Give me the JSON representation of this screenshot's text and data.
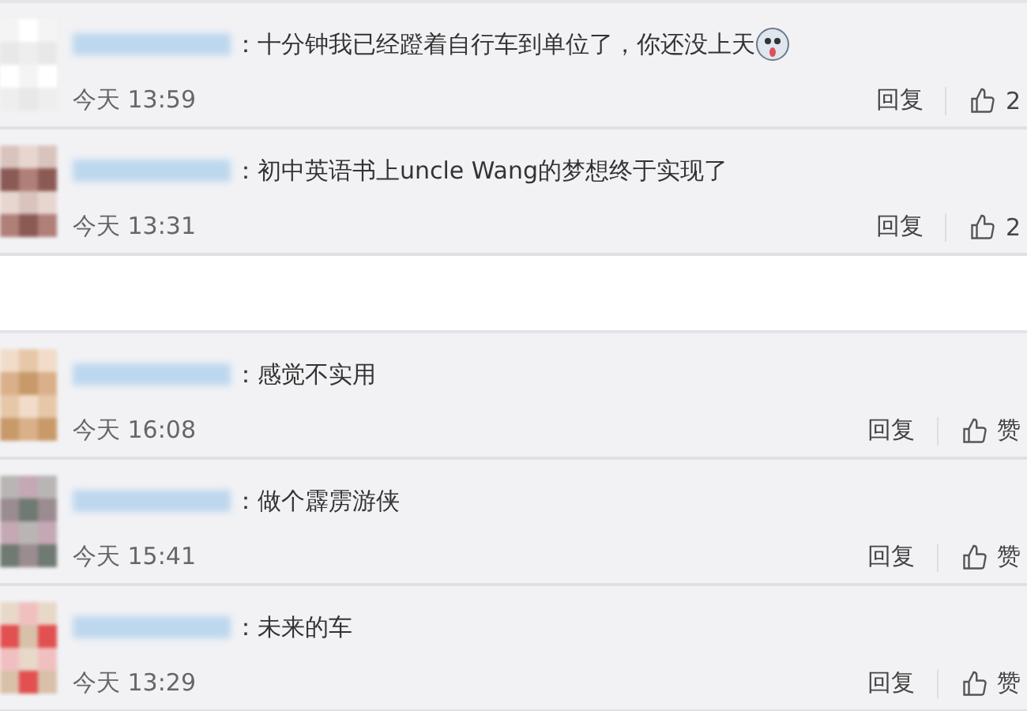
{
  "panels": [
    {
      "comments": [
        {
          "text": "：十分钟我已经蹬着自行车到单位了，你还没上天",
          "emoji": true,
          "time": "今天 13:59",
          "reply": "回复",
          "likes": "2"
        },
        {
          "text": "：初中英语书上uncle Wang的梦想终于实现了",
          "emoji": false,
          "time": "今天 13:31",
          "reply": "回复",
          "likes": "2"
        }
      ]
    },
    {
      "comments": [
        {
          "text": "：感觉不实用",
          "emoji": false,
          "time": "今天 16:08",
          "reply": "回复",
          "likes": "赞"
        },
        {
          "text": "：做个霹雳游侠",
          "emoji": false,
          "time": "今天 15:41",
          "reply": "回复",
          "likes": "赞"
        },
        {
          "text": "：未来的车",
          "emoji": false,
          "time": "今天 13:29",
          "reply": "回复",
          "likes": "赞"
        }
      ]
    }
  ]
}
